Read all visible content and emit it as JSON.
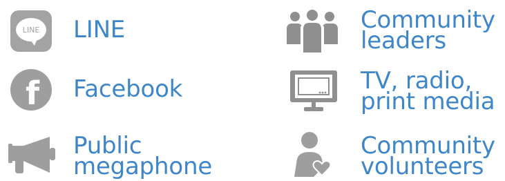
{
  "colors": {
    "label": "#3f86c9",
    "icon": "#9e9e9e",
    "icon_dark": "#8f8f8f"
  },
  "items": [
    {
      "label": "LINE",
      "icon": "line-app-icon",
      "icon_text": "LINE"
    },
    {
      "label": "Community\nleaders",
      "icon": "people-group-icon"
    },
    {
      "label": "Facebook",
      "icon": "facebook-icon",
      "icon_text": "f"
    },
    {
      "label": "TV, radio,\nprint media",
      "icon": "tv-monitor-icon"
    },
    {
      "label": "Public\nmegaphone",
      "icon": "megaphone-icon"
    },
    {
      "label": "Community\nvolunteers",
      "icon": "volunteer-heart-icon"
    }
  ]
}
